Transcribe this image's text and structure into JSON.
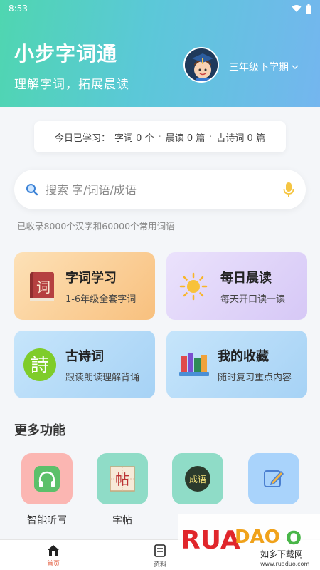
{
  "status": {
    "time": "8:53"
  },
  "header": {
    "title": "小步字词通",
    "subtitle": "理解字词，拓展晨读",
    "grade": "三年级下学期"
  },
  "progress": {
    "label": "今日已学习：",
    "items": [
      "字词 0 个",
      "晨读 0 篇",
      "古诗词 0 篇"
    ],
    "separator": "·"
  },
  "search": {
    "placeholder": "搜索 字/词语/成语",
    "note": "已收录8000个汉字和60000个常用词语"
  },
  "cards": [
    {
      "title": "字词学习",
      "desc": "1-6年级全套字词",
      "icon": "book-icon"
    },
    {
      "title": "每日晨读",
      "desc": "每天开口读一读",
      "icon": "sun-icon"
    },
    {
      "title": "古诗词",
      "desc": "跟读朗读理解背诵",
      "icon": "poem-icon"
    },
    {
      "title": "我的收藏",
      "desc": "随时复习重点内容",
      "icon": "books-icon"
    }
  ],
  "more": {
    "title": "更多功能",
    "items": [
      {
        "label": "智能听写",
        "icon": "headphones-icon",
        "color": "#f9a7a7"
      },
      {
        "label": "字帖",
        "icon": "copybook-icon",
        "color": "#8edcc8"
      },
      {
        "label": "",
        "icon": "idiom-icon",
        "color": "#8edcc8"
      },
      {
        "label": "",
        "icon": "edit-icon",
        "color": "#a9d3fb"
      }
    ]
  },
  "tabs": [
    {
      "label": "首页",
      "active": true
    },
    {
      "label": "资料",
      "active": false
    }
  ],
  "watermark": {
    "brand": "RUANDAOO",
    "text": "如多下载网",
    "url": "www.ruaduo.com"
  },
  "colors": {
    "accent": "#e35b3c",
    "header_start": "#4fd6b0",
    "header_end": "#74b6ef"
  }
}
